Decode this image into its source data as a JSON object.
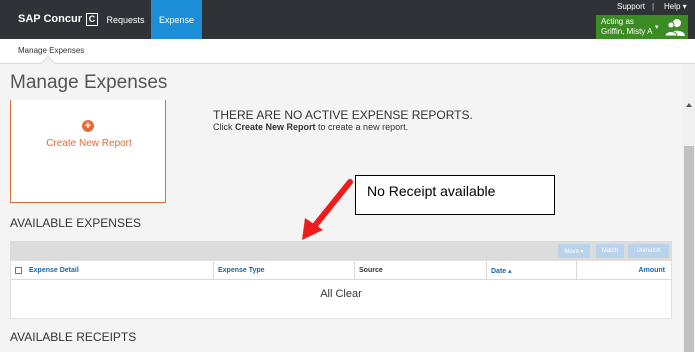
{
  "topbar": {
    "logo_text": "SAP Concur",
    "logo_mark": "C",
    "nav": [
      "Requests",
      "Expense"
    ],
    "support": "Support",
    "separator": "|",
    "help": "Help ▾",
    "acting_label": "Acting as",
    "acting_name": "Griffin, Misty A",
    "acting_chevron": "▾",
    "active_color": "#1d8fd9",
    "acting_color": "#3c8c25"
  },
  "subnav": {
    "item": "Manage Expenses"
  },
  "page": {
    "title": "Manage Expenses"
  },
  "new_report": {
    "icon": "plus-circle-icon",
    "label": "Create New Report"
  },
  "no_active": {
    "title": "THERE ARE NO ACTIVE EXPENSE REPORTS.",
    "sub_prefix": "Click ",
    "sub_link": "Create New Report",
    "sub_suffix": " to create a new report."
  },
  "available_expenses": {
    "title": "AVAILABLE EXPENSES",
    "toolbar": {
      "move": "Move ▾",
      "match": "Match",
      "unmatch": "Unmatch"
    },
    "columns": [
      "Expense Detail",
      "Expense Type",
      "Source",
      "Date ▴",
      "Amount"
    ],
    "empty_text": "All Clear"
  },
  "available_receipts": {
    "title": "AVAILABLE RECEIPTS"
  },
  "annotation": {
    "text": "No Receipt available",
    "arrow_color": "#ee1c1c"
  }
}
